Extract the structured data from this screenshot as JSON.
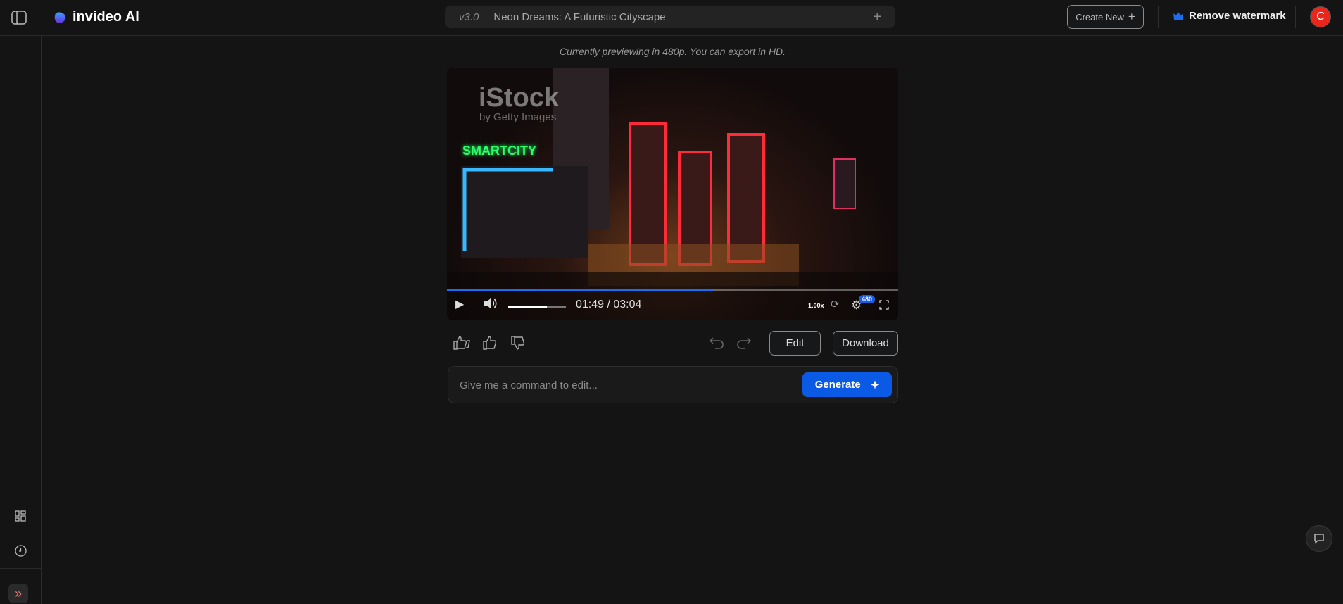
{
  "header": {
    "brand": "invideo AI",
    "version": "v3.0",
    "project_title": "Neon Dreams: A Futuristic Cityscape",
    "create_new": "Create New",
    "remove_watermark": "Remove watermark",
    "avatar_initial": "C"
  },
  "preview_note": "Currently previewing in 480p. You can export in HD.",
  "video": {
    "watermark": "iStock",
    "watermark_sub": "by Getty Images",
    "sign_text": "SMARTCITY",
    "time": "01:49 / 03:04",
    "speed": "1.00x",
    "quality": "480",
    "progress": 0.59,
    "volume": 0.67
  },
  "actions": {
    "edit": "Edit",
    "download": "Download"
  },
  "command": {
    "placeholder": "Give me a command to edit...",
    "generate": "Generate"
  },
  "colors": {
    "accent": "#0a5ae6",
    "avatar": "#e8261c"
  }
}
